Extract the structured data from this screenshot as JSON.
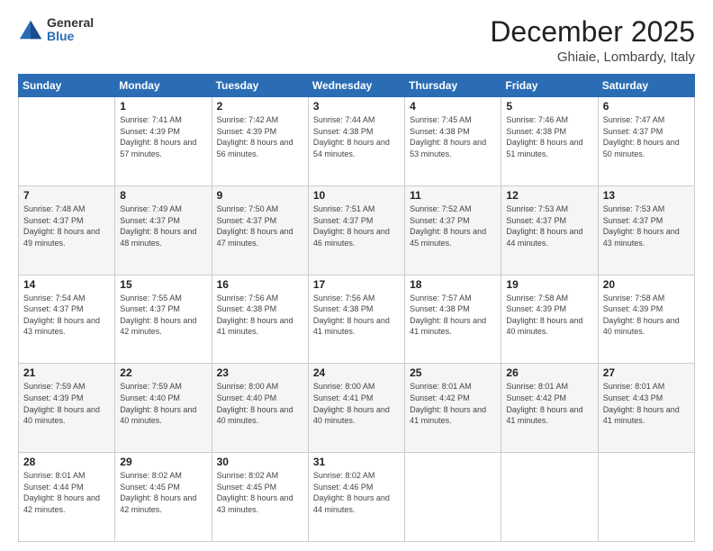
{
  "header": {
    "logo_general": "General",
    "logo_blue": "Blue",
    "month": "December 2025",
    "location": "Ghiaie, Lombardy, Italy"
  },
  "days_of_week": [
    "Sunday",
    "Monday",
    "Tuesday",
    "Wednesday",
    "Thursday",
    "Friday",
    "Saturday"
  ],
  "weeks": [
    [
      {
        "day": "",
        "sunrise": "",
        "sunset": "",
        "daylight": ""
      },
      {
        "day": "1",
        "sunrise": "Sunrise: 7:41 AM",
        "sunset": "Sunset: 4:39 PM",
        "daylight": "Daylight: 8 hours and 57 minutes."
      },
      {
        "day": "2",
        "sunrise": "Sunrise: 7:42 AM",
        "sunset": "Sunset: 4:39 PM",
        "daylight": "Daylight: 8 hours and 56 minutes."
      },
      {
        "day": "3",
        "sunrise": "Sunrise: 7:44 AM",
        "sunset": "Sunset: 4:38 PM",
        "daylight": "Daylight: 8 hours and 54 minutes."
      },
      {
        "day": "4",
        "sunrise": "Sunrise: 7:45 AM",
        "sunset": "Sunset: 4:38 PM",
        "daylight": "Daylight: 8 hours and 53 minutes."
      },
      {
        "day": "5",
        "sunrise": "Sunrise: 7:46 AM",
        "sunset": "Sunset: 4:38 PM",
        "daylight": "Daylight: 8 hours and 51 minutes."
      },
      {
        "day": "6",
        "sunrise": "Sunrise: 7:47 AM",
        "sunset": "Sunset: 4:37 PM",
        "daylight": "Daylight: 8 hours and 50 minutes."
      }
    ],
    [
      {
        "day": "7",
        "sunrise": "Sunrise: 7:48 AM",
        "sunset": "Sunset: 4:37 PM",
        "daylight": "Daylight: 8 hours and 49 minutes."
      },
      {
        "day": "8",
        "sunrise": "Sunrise: 7:49 AM",
        "sunset": "Sunset: 4:37 PM",
        "daylight": "Daylight: 8 hours and 48 minutes."
      },
      {
        "day": "9",
        "sunrise": "Sunrise: 7:50 AM",
        "sunset": "Sunset: 4:37 PM",
        "daylight": "Daylight: 8 hours and 47 minutes."
      },
      {
        "day": "10",
        "sunrise": "Sunrise: 7:51 AM",
        "sunset": "Sunset: 4:37 PM",
        "daylight": "Daylight: 8 hours and 46 minutes."
      },
      {
        "day": "11",
        "sunrise": "Sunrise: 7:52 AM",
        "sunset": "Sunset: 4:37 PM",
        "daylight": "Daylight: 8 hours and 45 minutes."
      },
      {
        "day": "12",
        "sunrise": "Sunrise: 7:53 AM",
        "sunset": "Sunset: 4:37 PM",
        "daylight": "Daylight: 8 hours and 44 minutes."
      },
      {
        "day": "13",
        "sunrise": "Sunrise: 7:53 AM",
        "sunset": "Sunset: 4:37 PM",
        "daylight": "Daylight: 8 hours and 43 minutes."
      }
    ],
    [
      {
        "day": "14",
        "sunrise": "Sunrise: 7:54 AM",
        "sunset": "Sunset: 4:37 PM",
        "daylight": "Daylight: 8 hours and 43 minutes."
      },
      {
        "day": "15",
        "sunrise": "Sunrise: 7:55 AM",
        "sunset": "Sunset: 4:37 PM",
        "daylight": "Daylight: 8 hours and 42 minutes."
      },
      {
        "day": "16",
        "sunrise": "Sunrise: 7:56 AM",
        "sunset": "Sunset: 4:38 PM",
        "daylight": "Daylight: 8 hours and 41 minutes."
      },
      {
        "day": "17",
        "sunrise": "Sunrise: 7:56 AM",
        "sunset": "Sunset: 4:38 PM",
        "daylight": "Daylight: 8 hours and 41 minutes."
      },
      {
        "day": "18",
        "sunrise": "Sunrise: 7:57 AM",
        "sunset": "Sunset: 4:38 PM",
        "daylight": "Daylight: 8 hours and 41 minutes."
      },
      {
        "day": "19",
        "sunrise": "Sunrise: 7:58 AM",
        "sunset": "Sunset: 4:39 PM",
        "daylight": "Daylight: 8 hours and 40 minutes."
      },
      {
        "day": "20",
        "sunrise": "Sunrise: 7:58 AM",
        "sunset": "Sunset: 4:39 PM",
        "daylight": "Daylight: 8 hours and 40 minutes."
      }
    ],
    [
      {
        "day": "21",
        "sunrise": "Sunrise: 7:59 AM",
        "sunset": "Sunset: 4:39 PM",
        "daylight": "Daylight: 8 hours and 40 minutes."
      },
      {
        "day": "22",
        "sunrise": "Sunrise: 7:59 AM",
        "sunset": "Sunset: 4:40 PM",
        "daylight": "Daylight: 8 hours and 40 minutes."
      },
      {
        "day": "23",
        "sunrise": "Sunrise: 8:00 AM",
        "sunset": "Sunset: 4:40 PM",
        "daylight": "Daylight: 8 hours and 40 minutes."
      },
      {
        "day": "24",
        "sunrise": "Sunrise: 8:00 AM",
        "sunset": "Sunset: 4:41 PM",
        "daylight": "Daylight: 8 hours and 40 minutes."
      },
      {
        "day": "25",
        "sunrise": "Sunrise: 8:01 AM",
        "sunset": "Sunset: 4:42 PM",
        "daylight": "Daylight: 8 hours and 41 minutes."
      },
      {
        "day": "26",
        "sunrise": "Sunrise: 8:01 AM",
        "sunset": "Sunset: 4:42 PM",
        "daylight": "Daylight: 8 hours and 41 minutes."
      },
      {
        "day": "27",
        "sunrise": "Sunrise: 8:01 AM",
        "sunset": "Sunset: 4:43 PM",
        "daylight": "Daylight: 8 hours and 41 minutes."
      }
    ],
    [
      {
        "day": "28",
        "sunrise": "Sunrise: 8:01 AM",
        "sunset": "Sunset: 4:44 PM",
        "daylight": "Daylight: 8 hours and 42 minutes."
      },
      {
        "day": "29",
        "sunrise": "Sunrise: 8:02 AM",
        "sunset": "Sunset: 4:45 PM",
        "daylight": "Daylight: 8 hours and 42 minutes."
      },
      {
        "day": "30",
        "sunrise": "Sunrise: 8:02 AM",
        "sunset": "Sunset: 4:45 PM",
        "daylight": "Daylight: 8 hours and 43 minutes."
      },
      {
        "day": "31",
        "sunrise": "Sunrise: 8:02 AM",
        "sunset": "Sunset: 4:46 PM",
        "daylight": "Daylight: 8 hours and 44 minutes."
      },
      {
        "day": "",
        "sunrise": "",
        "sunset": "",
        "daylight": ""
      },
      {
        "day": "",
        "sunrise": "",
        "sunset": "",
        "daylight": ""
      },
      {
        "day": "",
        "sunrise": "",
        "sunset": "",
        "daylight": ""
      }
    ]
  ]
}
